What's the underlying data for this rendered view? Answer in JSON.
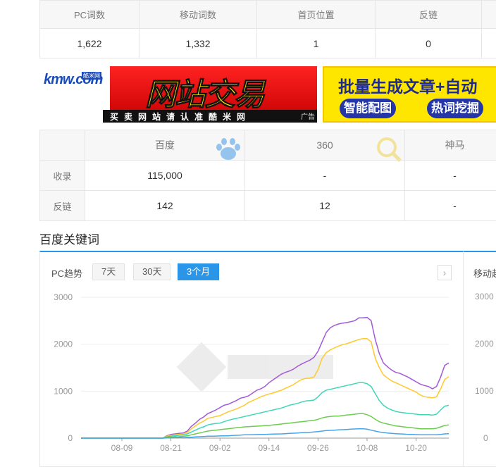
{
  "stats": {
    "headers": [
      "PC词数",
      "移动词数",
      "首页位置",
      "反链",
      ""
    ],
    "values": [
      "1,622",
      "1,332",
      "1",
      "0",
      ""
    ]
  },
  "banners": {
    "left": {
      "logo": "kmw.com",
      "logo_sub": "酷米网",
      "title": "网站交易",
      "subtitle": "买卖网站请认准酷米网",
      "ad": "广告"
    },
    "right": {
      "title": "批量生成文章+自动",
      "btn1": "智能配图",
      "btn2": "热词挖掘"
    }
  },
  "engines": {
    "headers": [
      "",
      "百度",
      "360",
      "神马"
    ],
    "rows": [
      {
        "label": "收录",
        "cells": [
          "115,000",
          "-",
          "-"
        ]
      },
      {
        "label": "反链",
        "cells": [
          "142",
          "12",
          "-"
        ]
      }
    ]
  },
  "section_title": "百度关键词",
  "panel": {
    "label": "PC趋势",
    "ranges": [
      "7天",
      "30天",
      "3个月"
    ],
    "active_range": "3个月",
    "arrow": "›"
  },
  "panel2": {
    "label": "移动趋势",
    "y_ticks": [
      "3000",
      "2000",
      "1000",
      "0"
    ]
  },
  "colors": {
    "accent": "#2b96e8",
    "series": [
      "#a259d9",
      "#ffc82c",
      "#3fd6b8",
      "#6dcc4f",
      "#46a5e8"
    ]
  },
  "chart_data": {
    "type": "line",
    "ylim": [
      0,
      3000
    ],
    "y_ticks": [
      0,
      1000,
      2000,
      3000
    ],
    "x_tick_labels": [
      "08-09",
      "08-21",
      "09-02",
      "09-14",
      "09-26",
      "10-08",
      "10-20"
    ],
    "x_tick_index": [
      10,
      22,
      34,
      46,
      58,
      70,
      82
    ],
    "x": [
      "07-30",
      "07-31",
      "08-01",
      "08-02",
      "08-03",
      "08-04",
      "08-05",
      "08-06",
      "08-07",
      "08-08",
      "08-09",
      "08-10",
      "08-11",
      "08-12",
      "08-13",
      "08-14",
      "08-15",
      "08-16",
      "08-17",
      "08-18",
      "08-19",
      "08-20",
      "08-21",
      "08-22",
      "08-23",
      "08-24",
      "08-25",
      "08-26",
      "08-27",
      "08-28",
      "08-29",
      "08-30",
      "08-31",
      "09-01",
      "09-02",
      "09-03",
      "09-04",
      "09-05",
      "09-06",
      "09-07",
      "09-08",
      "09-09",
      "09-10",
      "09-11",
      "09-12",
      "09-13",
      "09-14",
      "09-15",
      "09-16",
      "09-17",
      "09-18",
      "09-19",
      "09-20",
      "09-21",
      "09-22",
      "09-23",
      "09-24",
      "09-25",
      "09-26",
      "09-27",
      "09-28",
      "09-29",
      "09-30",
      "10-01",
      "10-02",
      "10-03",
      "10-04",
      "10-05",
      "10-06",
      "10-07",
      "10-08",
      "10-09",
      "10-10",
      "10-11",
      "10-12",
      "10-13",
      "10-14",
      "10-15",
      "10-16",
      "10-17",
      "10-18",
      "10-19",
      "10-20",
      "10-21",
      "10-22",
      "10-23",
      "10-24",
      "10-25",
      "10-26",
      "10-27",
      "10-28"
    ],
    "series": [
      {
        "values": [
          0,
          0,
          0,
          0,
          0,
          0,
          0,
          0,
          0,
          0,
          0,
          0,
          0,
          0,
          0,
          0,
          0,
          0,
          0,
          0,
          0,
          50,
          80,
          90,
          100,
          110,
          150,
          250,
          320,
          400,
          450,
          520,
          560,
          600,
          650,
          700,
          720,
          760,
          800,
          850,
          870,
          900,
          960,
          1020,
          1050,
          1100,
          1180,
          1240,
          1300,
          1360,
          1400,
          1430,
          1470,
          1530,
          1580,
          1620,
          1660,
          1720,
          1850,
          2050,
          2250,
          2350,
          2400,
          2430,
          2450,
          2460,
          2480,
          2500,
          2560,
          2560,
          2570,
          2500,
          2100,
          1800,
          1600,
          1520,
          1450,
          1400,
          1380,
          1340,
          1300,
          1250,
          1200,
          1150,
          1120,
          1100,
          1050,
          1100,
          1300,
          1550,
          1600
        ]
      },
      {
        "values": [
          0,
          0,
          0,
          0,
          0,
          0,
          0,
          0,
          0,
          0,
          0,
          0,
          0,
          0,
          0,
          0,
          0,
          0,
          0,
          0,
          0,
          40,
          60,
          70,
          80,
          90,
          120,
          200,
          260,
          320,
          360,
          420,
          440,
          460,
          480,
          520,
          560,
          590,
          620,
          660,
          700,
          760,
          800,
          840,
          880,
          910,
          940,
          960,
          990,
          1020,
          1060,
          1100,
          1140,
          1200,
          1250,
          1270,
          1280,
          1300,
          1460,
          1700,
          1820,
          1880,
          1920,
          1960,
          1990,
          2010,
          2040,
          2070,
          2100,
          2120,
          2120,
          2050,
          1700,
          1500,
          1350,
          1280,
          1220,
          1180,
          1140,
          1100,
          1060,
          1020,
          980,
          920,
          880,
          870,
          860,
          880,
          1050,
          1250,
          1310
        ]
      },
      {
        "values": [
          0,
          0,
          0,
          0,
          0,
          0,
          0,
          0,
          0,
          0,
          0,
          0,
          0,
          0,
          0,
          0,
          0,
          0,
          0,
          0,
          0,
          30,
          40,
          50,
          60,
          70,
          90,
          130,
          170,
          210,
          240,
          280,
          300,
          310,
          320,
          350,
          380,
          400,
          420,
          440,
          460,
          480,
          500,
          520,
          540,
          560,
          580,
          600,
          620,
          640,
          670,
          700,
          720,
          740,
          770,
          790,
          800,
          810,
          880,
          970,
          1020,
          1040,
          1060,
          1080,
          1100,
          1120,
          1140,
          1160,
          1180,
          1180,
          1160,
          1100,
          950,
          800,
          700,
          640,
          600,
          570,
          550,
          540,
          530,
          520,
          510,
          500,
          500,
          500,
          490,
          510,
          600,
          680,
          700
        ]
      },
      {
        "values": [
          0,
          0,
          0,
          0,
          0,
          0,
          0,
          0,
          0,
          0,
          0,
          0,
          0,
          0,
          0,
          0,
          0,
          0,
          0,
          0,
          0,
          15,
          20,
          25,
          30,
          40,
          50,
          70,
          90,
          110,
          130,
          150,
          160,
          170,
          180,
          190,
          200,
          210,
          220,
          230,
          240,
          245,
          250,
          255,
          260,
          265,
          270,
          280,
          290,
          300,
          310,
          320,
          330,
          340,
          350,
          360,
          370,
          380,
          400,
          430,
          450,
          460,
          470,
          470,
          480,
          490,
          500,
          510,
          520,
          520,
          500,
          460,
          400,
          350,
          320,
          300,
          280,
          260,
          250,
          240,
          230,
          220,
          210,
          200,
          200,
          200,
          200,
          210,
          240,
          270,
          280
        ]
      },
      {
        "values": [
          0,
          0,
          0,
          0,
          0,
          0,
          0,
          0,
          0,
          0,
          0,
          0,
          0,
          0,
          0,
          0,
          0,
          0,
          0,
          0,
          0,
          5,
          8,
          10,
          12,
          14,
          16,
          20,
          25,
          30,
          35,
          40,
          42,
          44,
          46,
          48,
          50,
          55,
          60,
          65,
          70,
          72,
          74,
          76,
          78,
          80,
          82,
          85,
          88,
          90,
          95,
          100,
          105,
          110,
          115,
          120,
          125,
          130,
          140,
          150,
          160,
          165,
          170,
          175,
          180,
          185,
          190,
          195,
          200,
          200,
          190,
          170,
          150,
          130,
          120,
          110,
          100,
          95,
          90,
          85,
          80,
          78,
          75,
          72,
          70,
          70,
          70,
          72,
          80,
          90,
          95
        ]
      }
    ]
  }
}
